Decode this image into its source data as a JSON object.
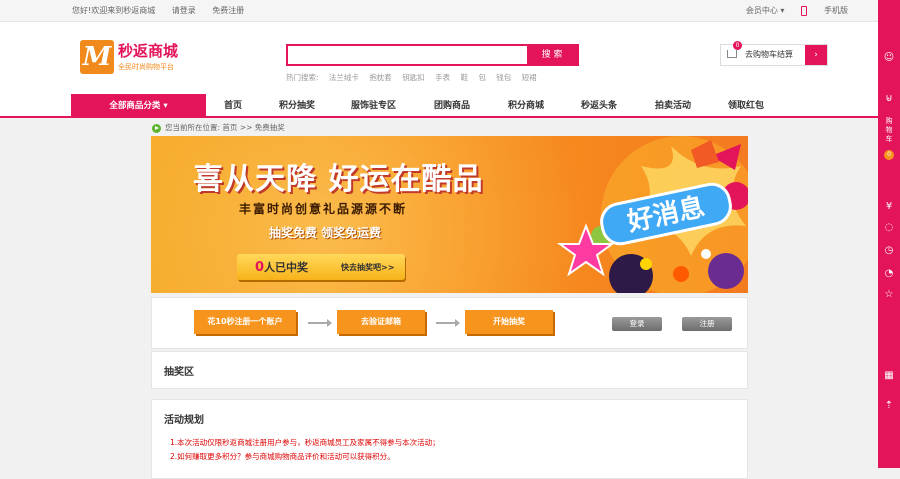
{
  "topbar": {
    "welcome": "您好!欢迎来到秒返商城",
    "login": "请登录",
    "register": "免费注册",
    "member": "会员中心",
    "mobile": "手机版"
  },
  "logo": {
    "mark": "M",
    "name": "秒返商城",
    "slogan": "全民时尚购物平台"
  },
  "search": {
    "placeholder": "",
    "button": "搜 索"
  },
  "hot": {
    "label": "热门搜索:",
    "items": [
      "法兰绒卡",
      "抱枕套",
      "钥匙扣",
      "手表",
      "鞋",
      "包",
      "钱包",
      "短裙"
    ]
  },
  "cart": {
    "label": "去购物车结算",
    "count": "0",
    "arrow": "›"
  },
  "nav": {
    "all": "全部商品分类 ▾",
    "items": [
      "首页",
      "积分抽奖",
      "服饰驻专区",
      "团购商品",
      "积分商城",
      "秒返头条",
      "拍卖活动",
      "领取红包"
    ]
  },
  "breadcrumb": {
    "prefix": "您当前所在位置:",
    "home": "首页",
    "sep": ">>",
    "current": "免费抽奖"
  },
  "banner": {
    "headline": "喜从天降  好运在酷品",
    "sub": "丰富时尚创意礼品源源不断",
    "tags": "抽奖免费  领奖免运费",
    "count_num": "0",
    "count_text": "人已中奖",
    "cta": "快去抽奖吧>>",
    "art_text": "好消息"
  },
  "steps": {
    "s1": "花10秒注册一个账户",
    "s2": "去验证邮箱",
    "s3": "开始抽奖",
    "login": "登录",
    "register": "注册"
  },
  "lottery": {
    "title": "抽奖区"
  },
  "plan": {
    "title": "活动规划",
    "rules": [
      "1.本次活动仅限秒返商城注册用户参与，秒返商城员工及家属不得参与本次活动；",
      "2.如何赚取更多积分？参与商城购物商品评价和活动可以获得积分。"
    ]
  },
  "side": {
    "cart_text": "购物车",
    "cart_count": "0"
  },
  "colors": {
    "brand": "#e4145a",
    "orange": "#f7941d"
  }
}
